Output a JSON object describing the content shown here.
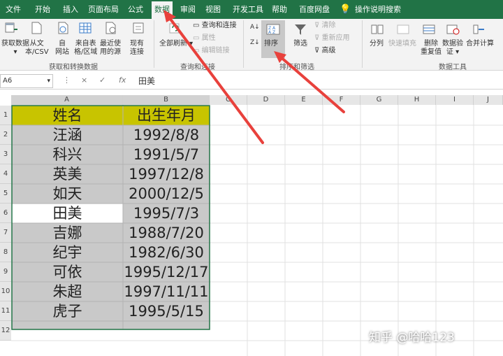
{
  "tabs": [
    "文件",
    "开始",
    "插入",
    "页面布局",
    "公式",
    "数据",
    "审阅",
    "视图",
    "开发工具",
    "帮助",
    "百度网盘",
    "操作说明搜索"
  ],
  "ribbon": {
    "get_data": "获取数据",
    "from_csv_1": "从文",
    "from_csv_2": "本/CSV",
    "from_web_1": "自",
    "from_web_2": "网站",
    "from_table_1": "来自表",
    "from_table_2": "格/区域",
    "recent_1": "最近使",
    "recent_2": "用的源",
    "existing_1": "现有",
    "existing_2": "连接",
    "group_get": "获取和转换数据",
    "refresh_all": "全部刷新",
    "queries": "查询和连接",
    "properties": "属性",
    "edit_links": "编辑链接",
    "group_queries": "查询和连接",
    "sort": "排序",
    "filter": "筛选",
    "clear": "清除",
    "reapply": "重新应用",
    "advanced": "高级",
    "group_sort": "排序和筛选",
    "split": "分列",
    "flash_fill": "快速填充",
    "remove_dup_1": "删除",
    "remove_dup_2": "重复值",
    "validation_1": "数据验",
    "validation_2": "证",
    "consolidate": "合并计算",
    "group_tools": "数据工具"
  },
  "formula_bar": {
    "name_box": "A6",
    "cancel": "×",
    "enter": "✓",
    "fx": "fx",
    "content": "田美"
  },
  "columns": [
    "A",
    "B",
    "C",
    "D",
    "E",
    "F",
    "G",
    "H",
    "I",
    "J"
  ],
  "rows": [
    "1",
    "2",
    "3",
    "4",
    "5",
    "6",
    "7",
    "8",
    "9",
    "10",
    "11",
    "12"
  ],
  "table": [
    [
      "姓名",
      "出生年月"
    ],
    [
      "汪涵",
      "1992/8/8"
    ],
    [
      "科兴",
      "1991/5/7"
    ],
    [
      "英美",
      "1997/12/8"
    ],
    [
      "如天",
      "2000/12/5"
    ],
    [
      "田美",
      "1995/7/3"
    ],
    [
      "吉娜",
      "1988/7/20"
    ],
    [
      "纪宇",
      "1982/6/30"
    ],
    [
      "可依",
      "1995/12/17"
    ],
    [
      "朱超",
      "1997/11/11"
    ],
    [
      "虎子",
      "1995/5/15"
    ]
  ],
  "colors": {
    "excel_green": "#217346",
    "header_fill": "#c8c400",
    "selection_fill": "#c9c9c9",
    "arrow": "#e8413c"
  },
  "watermark": "知乎 @哈哈123"
}
